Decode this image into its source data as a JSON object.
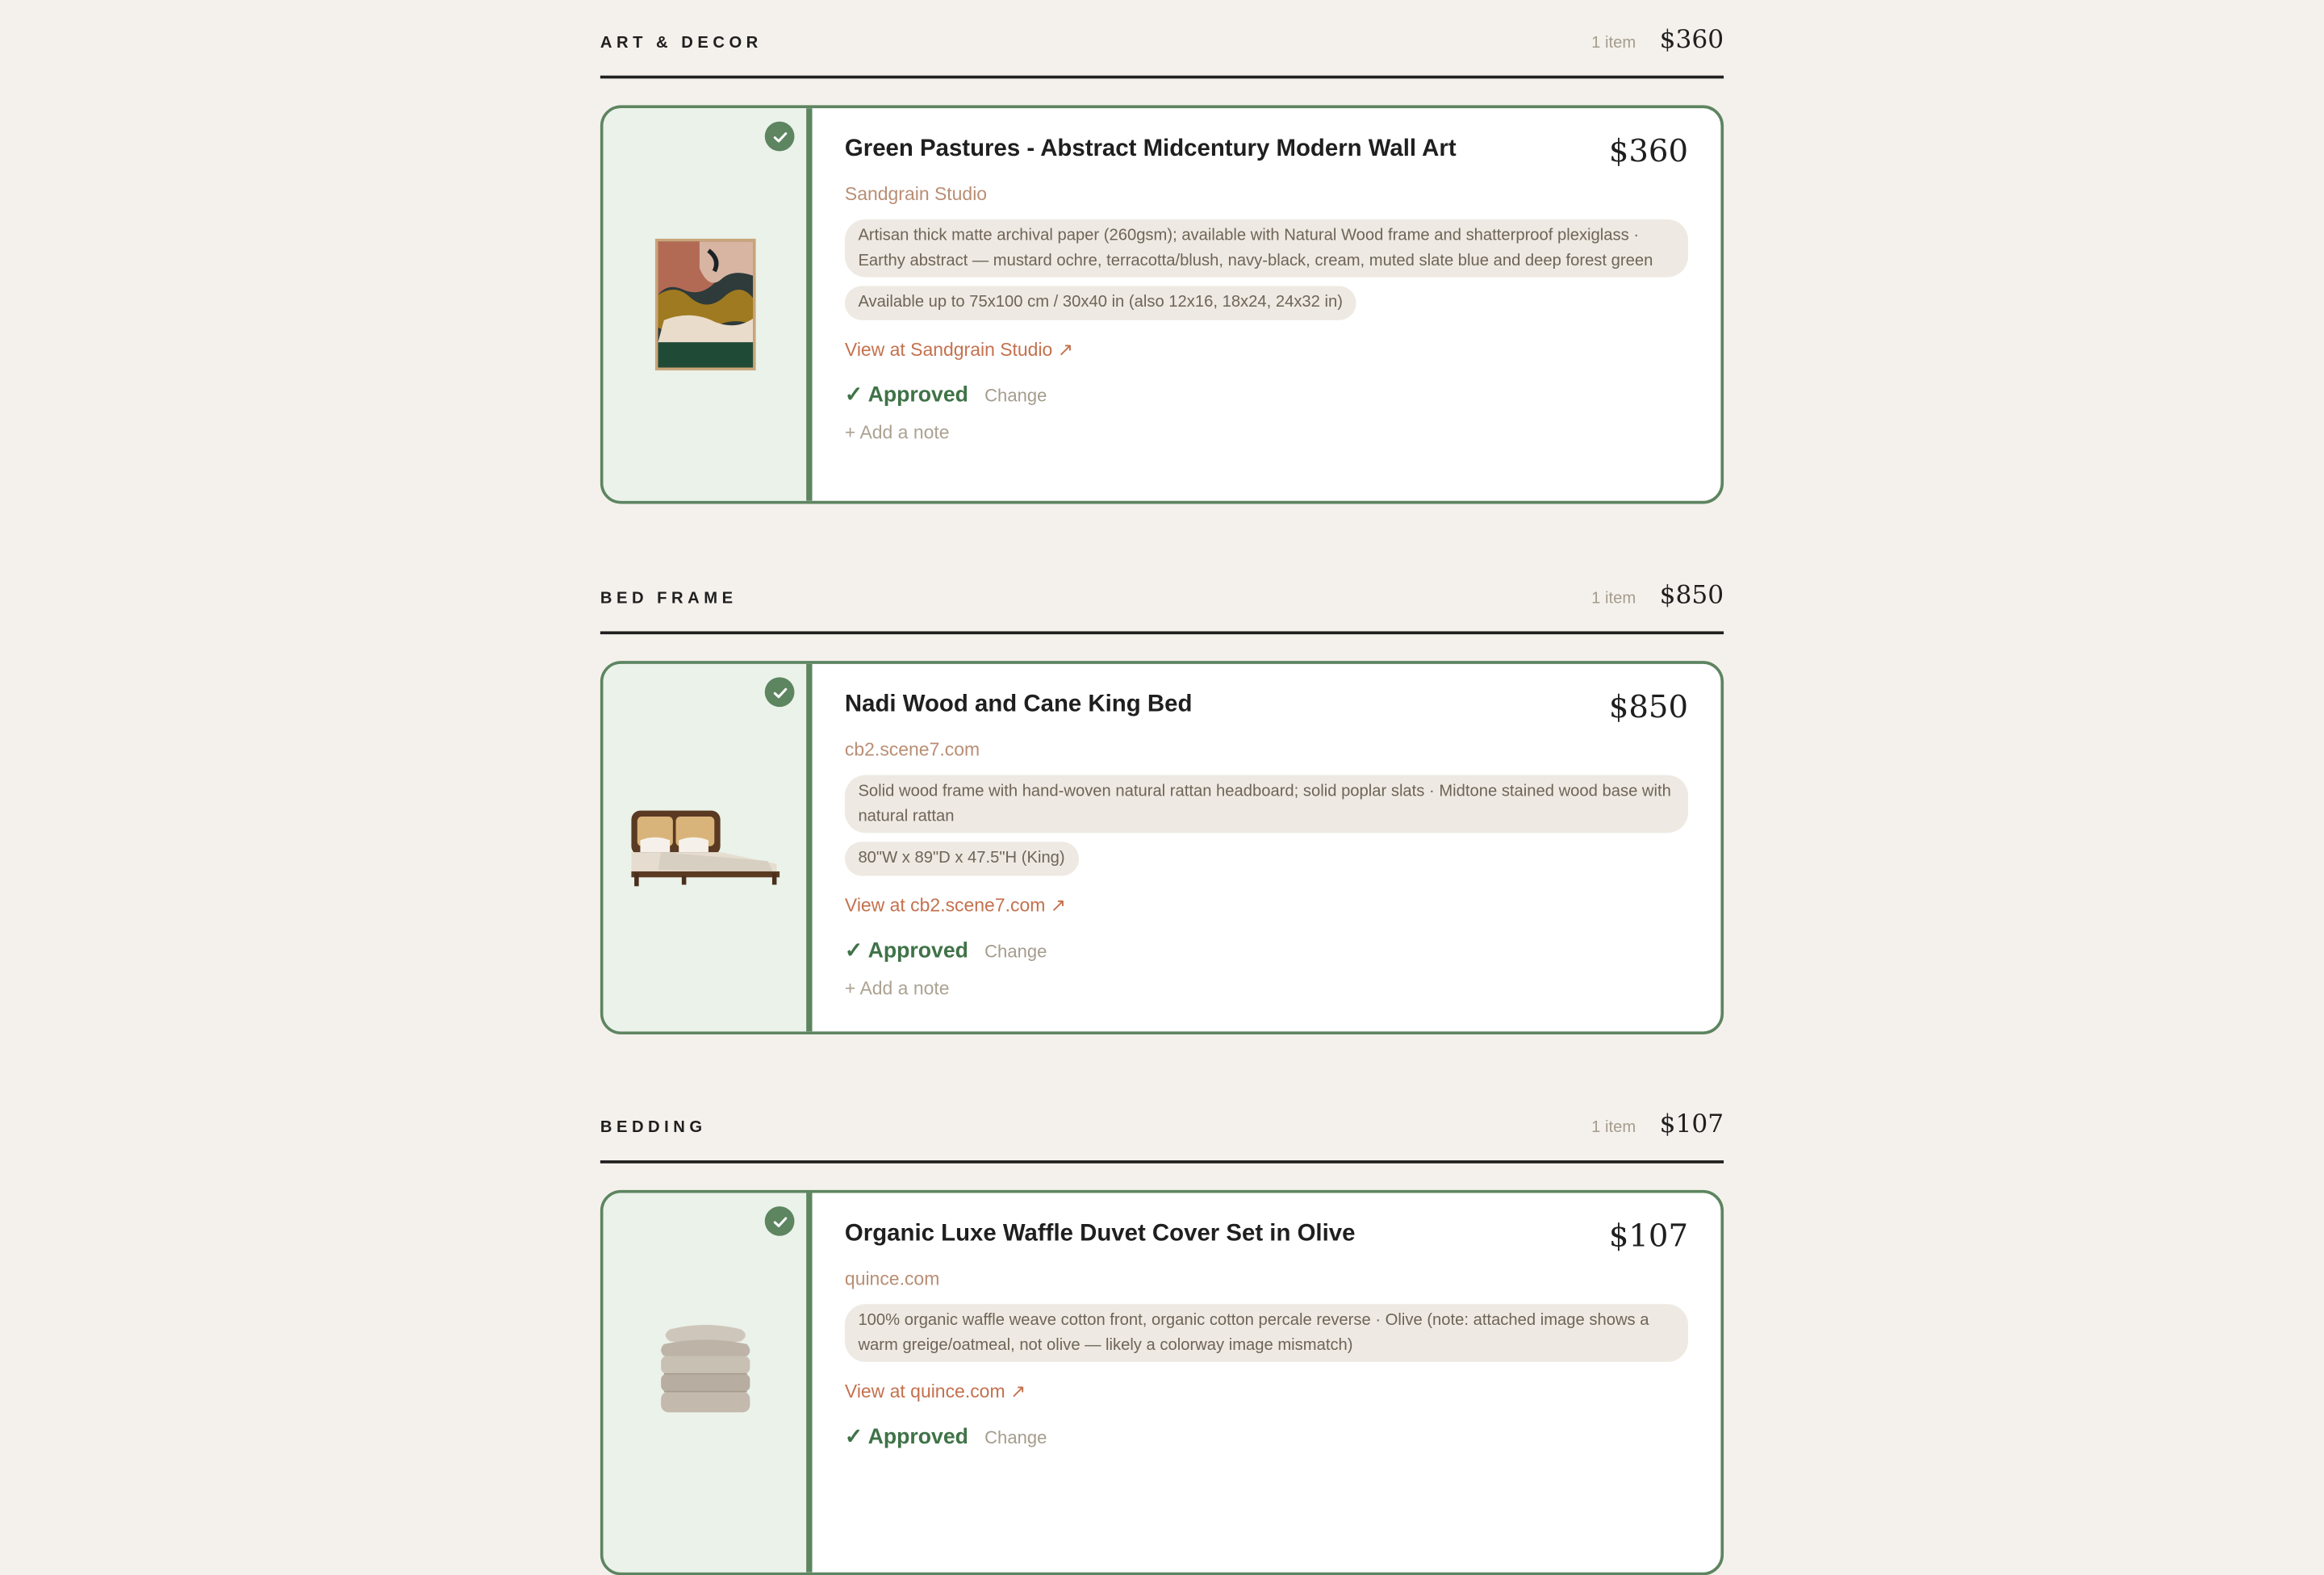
{
  "sections": [
    {
      "title": "ART & DECOR",
      "count": "1 item",
      "total": "$360",
      "item": {
        "title": "Green Pastures - Abstract Midcentury Modern Wall Art",
        "price": "$360",
        "vendor": "Sandgrain Studio",
        "description": "Artisan thick matte archival paper (260gsm); available with Natural Wood frame and shatterproof plexiglass · Earthy abstract — mustard ochre, terracotta/blush, navy-black, cream, muted slate blue and deep forest green",
        "dimensions": "Available up to 75x100 cm / 30x40 in (also 12x16, 18x24, 24x32 in)",
        "link": "View at Sandgrain Studio ↗",
        "status": "Approved",
        "change": "Change",
        "note": "+ Add a note",
        "image": "abstract-art-print"
      }
    },
    {
      "title": "BED FRAME",
      "count": "1 item",
      "total": "$850",
      "item": {
        "title": "Nadi Wood and Cane King Bed",
        "price": "$850",
        "vendor": "cb2.scene7.com",
        "description": "Solid wood frame with hand-woven natural rattan headboard; solid poplar slats · Midtone stained wood base with natural rattan",
        "dimensions": "80\"W x 89\"D x 47.5\"H (King)",
        "link": "View at cb2.scene7.com ↗",
        "status": "Approved",
        "change": "Change",
        "note": "+ Add a note",
        "image": "bed-frame"
      }
    },
    {
      "title": "BEDDING",
      "count": "1 item",
      "total": "$107",
      "item": {
        "title": "Organic Luxe Waffle Duvet Cover Set in Olive",
        "price": "$107",
        "vendor": "quince.com",
        "description": "100% organic waffle weave cotton front, organic cotton percale reverse · Olive (note: attached image shows a warm greige/oatmeal, not olive — likely a colorway image mismatch)",
        "link": "View at quince.com ↗",
        "status": "Approved",
        "change": "Change",
        "image": "folded-duvet"
      }
    }
  ],
  "colors": {
    "background": "#f4f1ec",
    "approved_green": "#3f7347",
    "card_border": "#5d8560",
    "link": "#c4714e"
  },
  "icons": {
    "check": "check-badge-icon",
    "external_link": "external-link-arrow"
  }
}
